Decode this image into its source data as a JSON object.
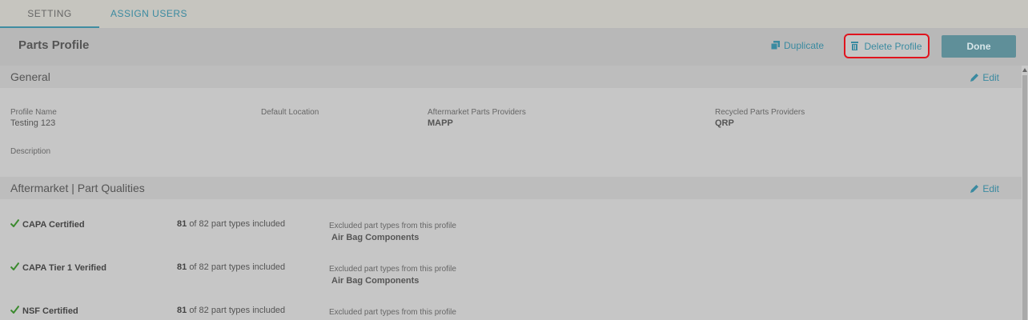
{
  "tabs": [
    {
      "label": "SETTING"
    },
    {
      "label": "ASSIGN USERS"
    }
  ],
  "header": {
    "title": "Parts Profile",
    "duplicate_label": "Duplicate",
    "delete_label": "Delete Profile",
    "done_label": "Done"
  },
  "general": {
    "title": "General",
    "edit_label": "Edit",
    "profile_name_label": "Profile Name",
    "profile_name_value": "Testing 123",
    "default_location_label": "Default Location",
    "aftermarket_label": "Aftermarket Parts Providers",
    "aftermarket_value": "MAPP",
    "recycled_label": "Recycled Parts Providers",
    "recycled_value": "QRP",
    "description_label": "Description"
  },
  "aftermarket": {
    "title": "Aftermarket | Part Qualities",
    "edit_label": "Edit",
    "excluded_label": "Excluded part types from this profile",
    "count_suffix": "of 82 part types included",
    "items": [
      {
        "name": "CAPA Certified",
        "count": "81",
        "excluded": "Air Bag Components"
      },
      {
        "name": "CAPA Tier 1 Verified",
        "count": "81",
        "excluded": "Air Bag Components"
      },
      {
        "name": "NSF Certified",
        "count": "81",
        "excluded": ""
      }
    ]
  },
  "colors": {
    "accent": "#3a8aa0",
    "done_button": "#5f8f99",
    "delete_outline": "#e0141e",
    "check": "#3b8a2e"
  }
}
